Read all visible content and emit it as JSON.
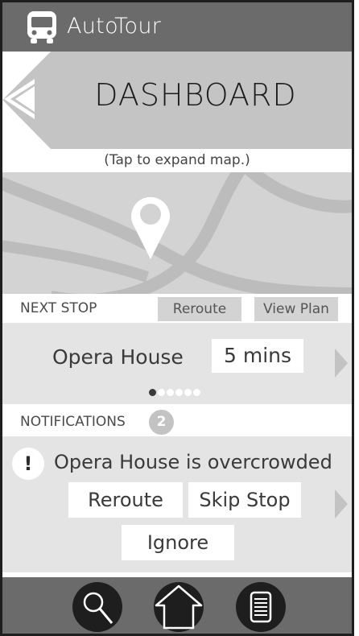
{
  "app": {
    "title": "AutoTour"
  },
  "dashboard": {
    "title": "DASHBOARD",
    "hint": "(Tap to expand map.)"
  },
  "next_stop": {
    "label": "NEXT STOP",
    "reroute_label": "Reroute",
    "view_plan_label": "View Plan",
    "stop_name": "Opera House",
    "eta": "5 mins",
    "page_count": 6,
    "active_page": 1
  },
  "notifications": {
    "label": "NOTIFICATIONS",
    "count": "2",
    "alert_symbol": "!",
    "message": "Opera House is overcrowded",
    "reroute_label": "Reroute",
    "skip_label": "Skip Stop",
    "ignore_label": "Ignore"
  },
  "nav": {
    "items": [
      "search-icon",
      "home-icon",
      "list-icon"
    ]
  },
  "colors": {
    "header": "#6b6b6b",
    "panel": "#e4e4e4",
    "map": "#d3d3d3",
    "road": "#bcbcbc"
  }
}
